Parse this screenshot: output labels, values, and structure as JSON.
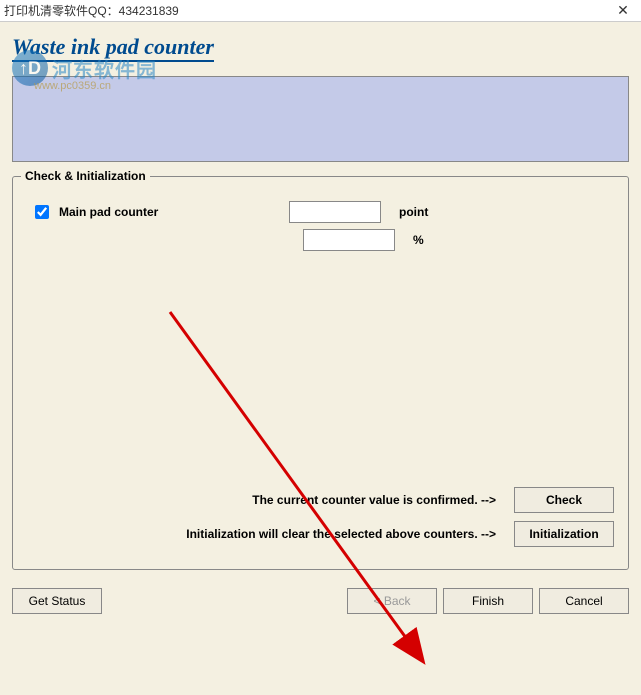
{
  "window": {
    "title": "打印机清零软件QQ：434231839",
    "close": "✕"
  },
  "watermark": {
    "logo_glyph": "↑D",
    "text": "河东软件园",
    "url": "www.pc0359.cn"
  },
  "heading": "Waste ink pad counter",
  "group": {
    "legend": "Check & Initialization",
    "main_pad_label": "Main pad counter",
    "main_pad_checked": true,
    "point_value": "",
    "point_unit": "point",
    "percent_value": "",
    "percent_unit": "%",
    "check_info": "The current counter value is confirmed. -->",
    "init_info": "Initialization will clear the selected above counters. -->",
    "check_btn": "Check",
    "init_btn": "Initialization"
  },
  "buttons": {
    "get_status": "Get Status",
    "back": "< Back",
    "finish": "Finish",
    "cancel": "Cancel"
  }
}
